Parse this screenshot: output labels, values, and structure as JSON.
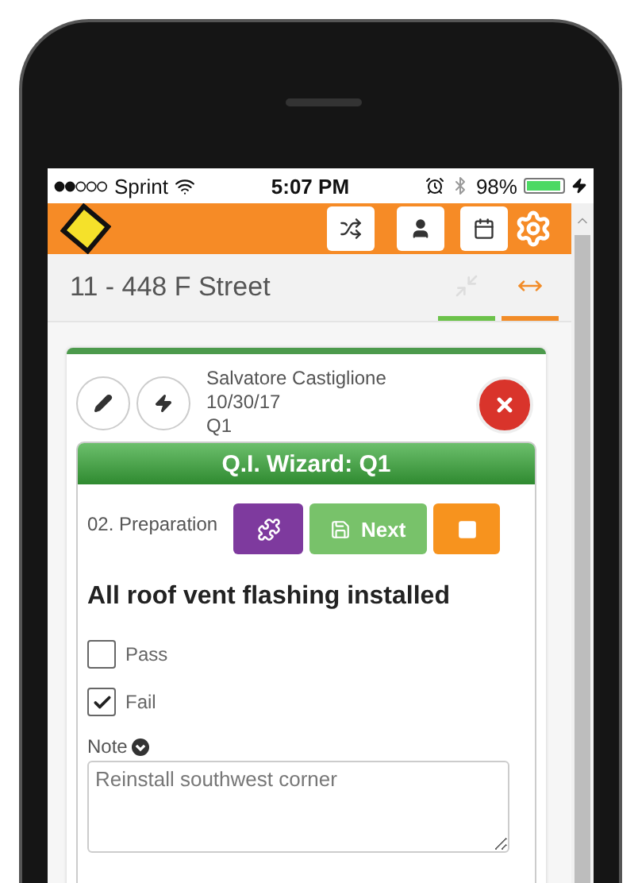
{
  "status_bar": {
    "carrier": "Sprint",
    "time": "5:07 PM",
    "battery": "98%"
  },
  "address": {
    "title": "11 - 448 F Street",
    "tabs": [
      {
        "kind": "collapse",
        "color": "#6cc24a"
      },
      {
        "kind": "expand",
        "color": "#f28c28"
      }
    ]
  },
  "record": {
    "name": "Salvatore Castiglione",
    "date": "10/30/17",
    "code": "Q1"
  },
  "wizard": {
    "title": "Q.I. Wizard: Q1",
    "step": "02. Preparation",
    "next_label": "Next",
    "question": "All roof vent flashing installed",
    "options": [
      {
        "label": "Pass",
        "checked": false
      },
      {
        "label": "Fail",
        "checked": true
      }
    ],
    "note": {
      "label": "Note",
      "value": "Reinstall southwest corner"
    }
  }
}
